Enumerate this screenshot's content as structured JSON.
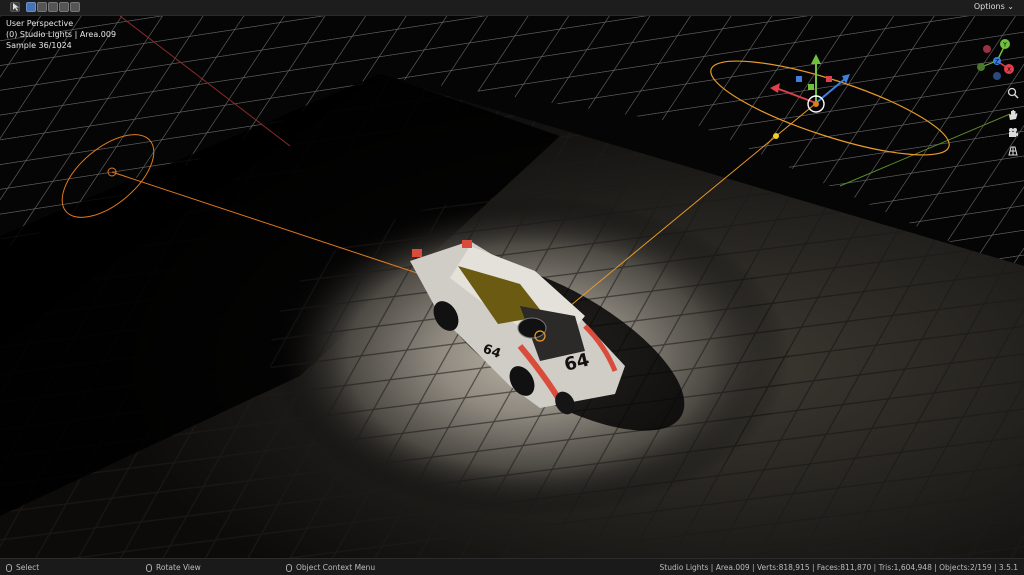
{
  "header": {
    "options_label": "Options",
    "options_chevron": "⌄"
  },
  "viewport": {
    "overlay_line1": "User Perspective",
    "overlay_line2": "(0) Studio Lights | Area.009",
    "overlay_line3": "Sample 36/1024",
    "car_number": "64"
  },
  "gizmo": {
    "axis_z": "Z",
    "axis_y": "Y",
    "axis_x": "X"
  },
  "statusbar": {
    "hint_select": "Select",
    "hint_rotate": "Rotate View",
    "hint_context": "Object Context Menu",
    "stats": "Studio Lights | Area.009 | Verts:818,915 | Faces:811,870 | Tris:1,604,948 | Objects:2/159 | 3.5.1"
  },
  "colors": {
    "axis_red": "#e0404c",
    "axis_green": "#6fc03c",
    "axis_blue": "#3f7fe0",
    "light_orange": "#e07a1c",
    "accent_blue": "#4772b3"
  },
  "icons": [
    "select-tool-icon",
    "select-box-icon",
    "select-extend-icon",
    "select-subtract-icon",
    "select-invert-icon",
    "zoom-icon",
    "hand-pan-icon",
    "camera-icon",
    "grid-view-icon",
    "mouse-left-icon",
    "mouse-middle-icon",
    "mouse-right-icon"
  ]
}
